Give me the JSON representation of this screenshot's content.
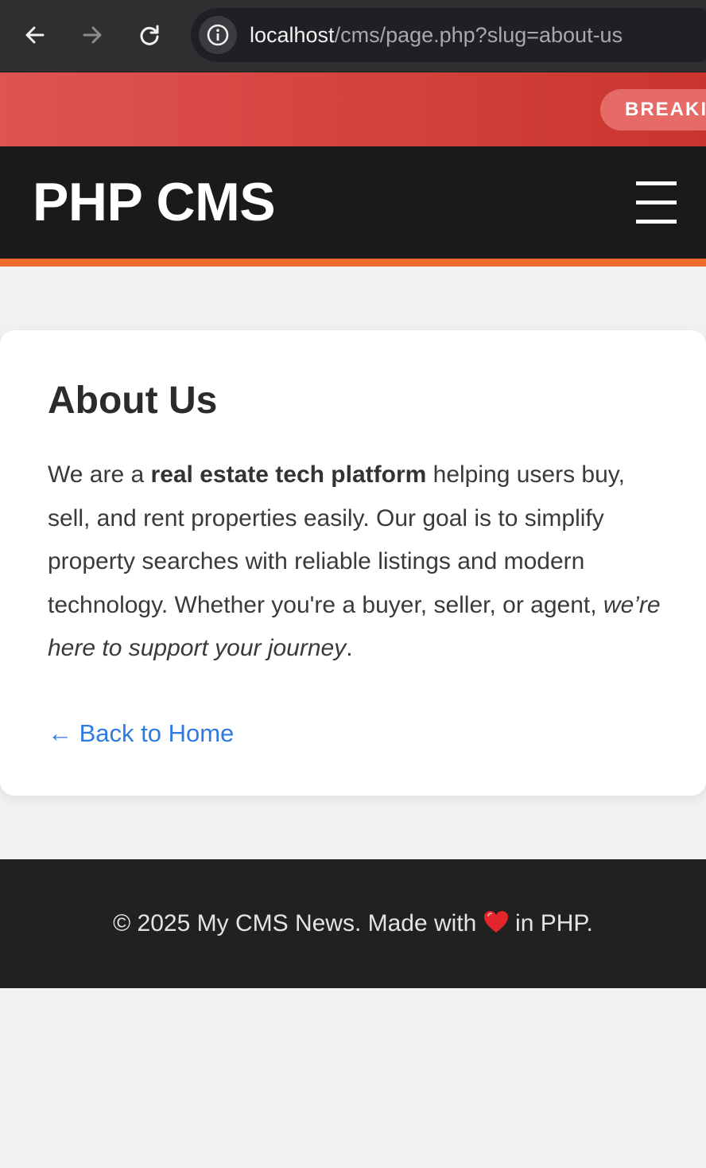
{
  "browser": {
    "back_icon": "arrow-left-icon",
    "forward_icon": "arrow-right-icon",
    "reload_icon": "reload-icon",
    "site_info_icon": "info-icon",
    "url_host": "localhost",
    "url_path": "/cms/page.php?slug=about-us"
  },
  "breaking": {
    "badge_label": "BREAKI"
  },
  "header": {
    "logo": "PHP CMS",
    "menu_icon": "hamburger-menu-icon"
  },
  "page": {
    "title": "About Us",
    "body": {
      "lead": "We are a ",
      "bold": "real estate tech platform",
      "middle": " helping users buy, sell, and rent properties easily. Our goal is to simplify property searches with reliable listings and modern technology. Whether you're a buyer, seller, or agent, ",
      "italic": "we’re here to support your journey",
      "end": "."
    },
    "back_link": "← Back to Home"
  },
  "footer": {
    "text_before": "© 2025 My CMS News. Made with ",
    "heart_icon": "heart-icon",
    "text_after": " in PHP."
  },
  "colors": {
    "breaking_red": "#d2413b",
    "header_dark": "#1a1a1a",
    "accent_orange": "#ec6a2a",
    "link_blue": "#2f7be0",
    "footer_dark": "#212121"
  }
}
